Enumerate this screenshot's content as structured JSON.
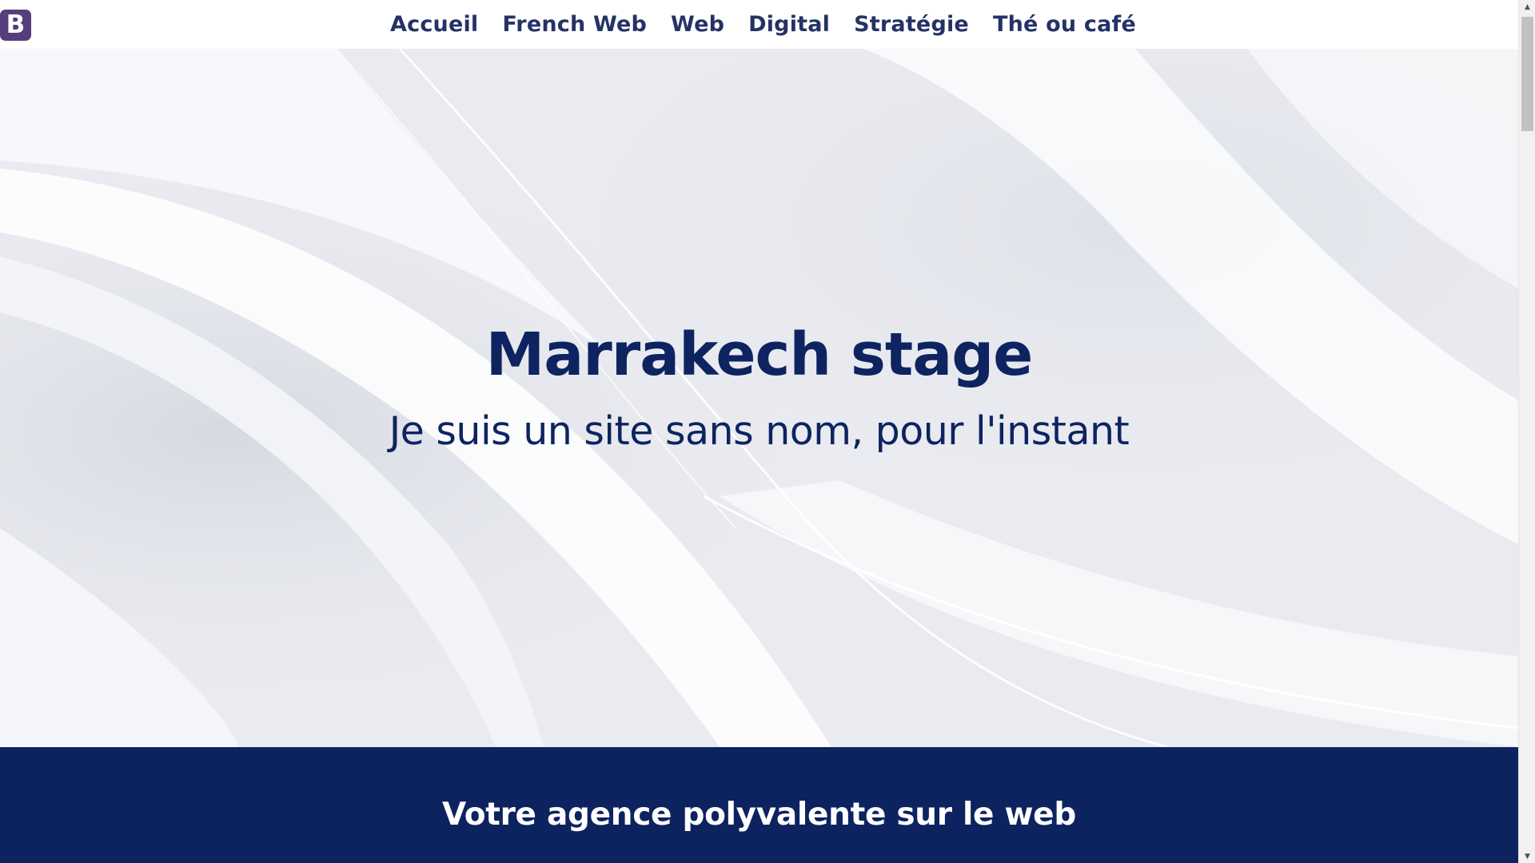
{
  "brand": {
    "logo_letter": "B",
    "color": "#563d7c"
  },
  "nav": {
    "items": [
      {
        "label": "Accueil"
      },
      {
        "label": "French Web"
      },
      {
        "label": "Web"
      },
      {
        "label": "Digital"
      },
      {
        "label": "Stratégie"
      },
      {
        "label": "Thé ou café"
      }
    ],
    "color": "#243266"
  },
  "hero": {
    "title": "Marrakech stage",
    "subtitle": "Je suis un site sans nom, pour l'instant",
    "text_color": "#0e2460"
  },
  "section": {
    "title": "Votre agence polyvalente sur le web",
    "background": "#0c2360"
  },
  "scrollbar": {
    "up_icon": "▲",
    "down_icon": "▼"
  }
}
